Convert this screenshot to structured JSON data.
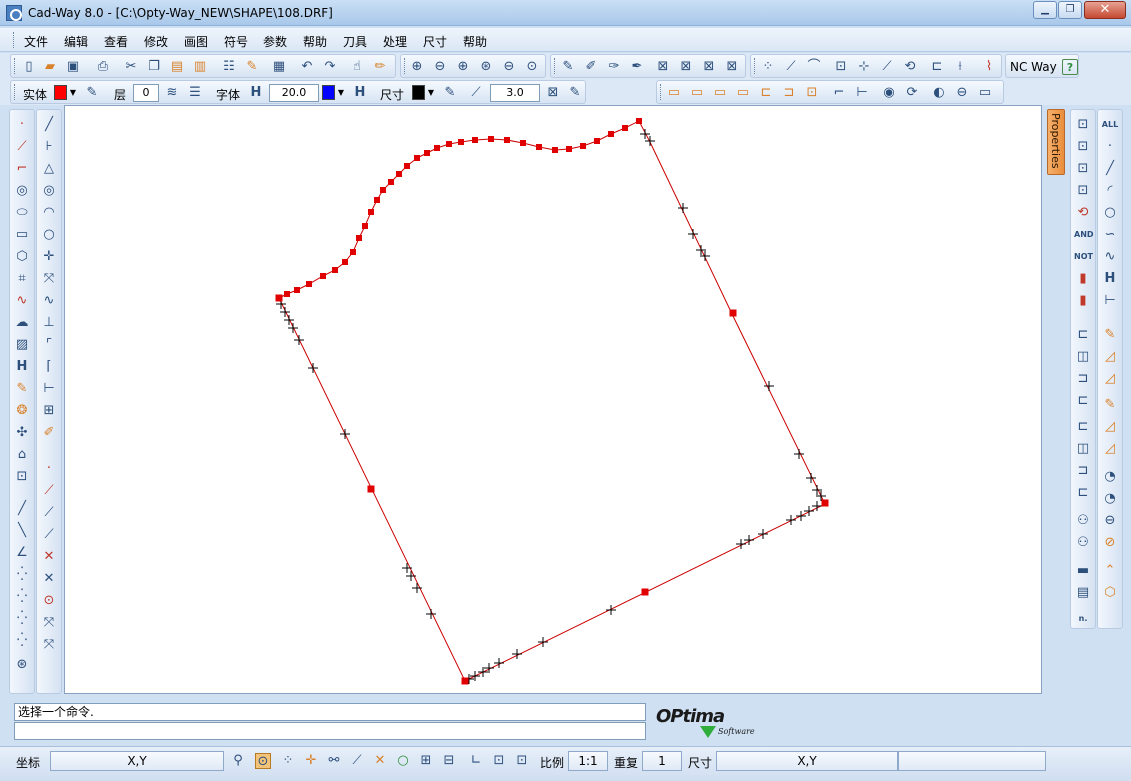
{
  "window": {
    "title": "Cad-Way 8.0 - [C:\\Opty-Way_NEW\\SHAPE\\108.DRF]",
    "minimize": "▁",
    "restore": "❐",
    "close": "✕"
  },
  "menu": [
    "文件",
    "编辑",
    "查看",
    "修改",
    "画图",
    "符号",
    "参数",
    "帮助",
    "刀具",
    "处理",
    "尺寸",
    "帮助"
  ],
  "toolbar1": {
    "nc_way_label": "NC Way",
    "help_icon": "?"
  },
  "toolbar2": {
    "entity_label": "实体",
    "entity_color": "#ff0000",
    "layer_label": "层",
    "layer_value": "0",
    "font_label": "字体",
    "font_height_icon": "H",
    "font_height_value": "20.0",
    "font_color": "#0000ff",
    "dim_label": "尺寸",
    "dim_color": "#000000",
    "dim_value": "3.0"
  },
  "properties_tab": "Properties",
  "right_toolbar_text": {
    "all": "ALL",
    "and": "AND",
    "not": "NOT",
    "n": "n."
  },
  "command": {
    "history": "选择一个命令.",
    "input": ""
  },
  "logo": {
    "text": "OPtima",
    "sub": "Software"
  },
  "status": {
    "coord_label": "坐标",
    "coord_value": "X,Y",
    "scale_label": "比例",
    "scale_value": "1:1",
    "repeat_label": "重复",
    "repeat_value": "1",
    "dim_label": "尺寸",
    "dim_value": "X,Y"
  },
  "drawing": {
    "entity_color": "#cc0000",
    "marker_color": "#e00000",
    "cross_color": "#000000"
  }
}
